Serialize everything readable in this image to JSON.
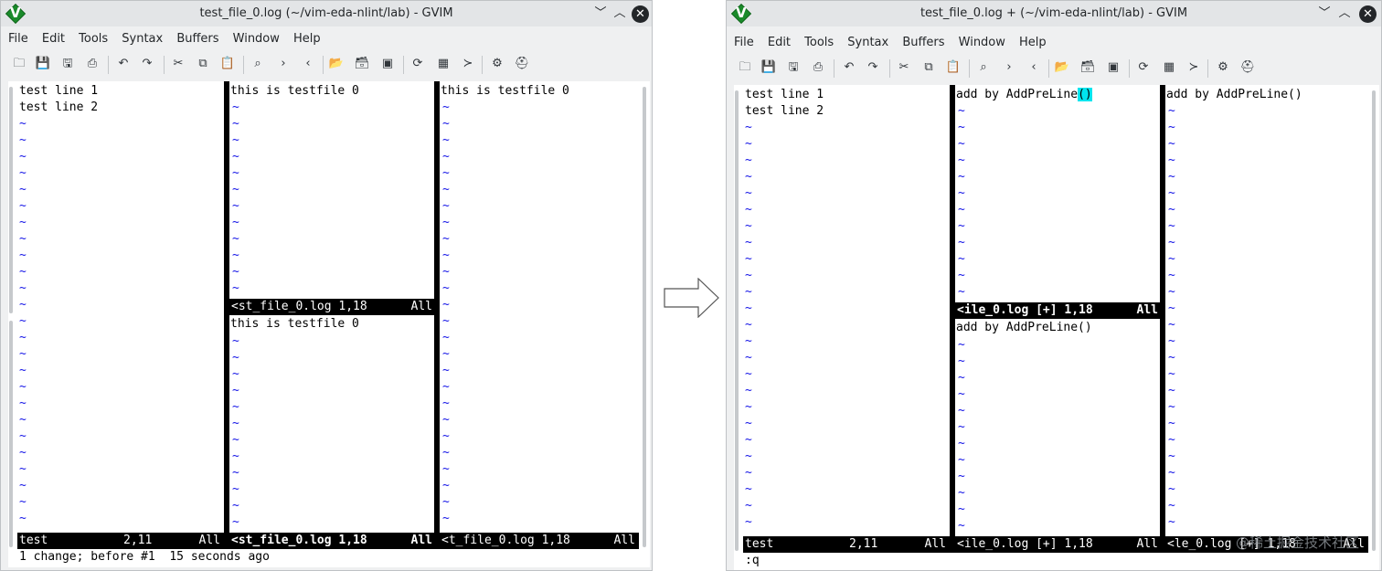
{
  "left_window": {
    "title": "test_file_0.log (~/vim-eda-nlint/lab) - GVIM",
    "menu": [
      "File",
      "Edit",
      "Tools",
      "Syntax",
      "Buffers",
      "Window",
      "Help"
    ],
    "pane1_lines": [
      "test line 1",
      "test line 2"
    ],
    "pane2_top_lines": [
      "this is testfile 0"
    ],
    "pane2_top_status": {
      "left": "<st_file_0.log 1,18",
      "right": "All"
    },
    "pane2_bottom_lines": [
      "this is testfile 0"
    ],
    "pane3_lines": [
      "this is testfile 0"
    ],
    "status": {
      "pane1": {
        "left": "test",
        "mid": "2,11",
        "right": "All"
      },
      "pane2": {
        "left": "<st_file_0.log 1,18",
        "right": "All"
      },
      "pane3": {
        "left": "<t_file_0.log 1,18",
        "right": "All"
      }
    },
    "cmdline": "1 change; before #1  15 seconds ago"
  },
  "right_window": {
    "title": "test_file_0.log + (~/vim-eda-nlint/lab) - GVIM",
    "menu": [
      "File",
      "Edit",
      "Tools",
      "Syntax",
      "Buffers",
      "Window",
      "Help"
    ],
    "pane1_lines": [
      "test line 1",
      "test line 2"
    ],
    "pane2_top_line_prefix": "add by AddPreLine",
    "pane2_top_line_match": "()",
    "pane2_top_status": {
      "left": "<ile_0.log [+] 1,18",
      "right": "All"
    },
    "pane2_bottom_lines": [
      "add by AddPreLine()"
    ],
    "pane3_lines": [
      "add by AddPreLine()"
    ],
    "status": {
      "pane1": {
        "left": "test",
        "mid": "2,11",
        "right": "All"
      },
      "pane2": {
        "left": "<ile_0.log [+] 1,18",
        "right": "All"
      },
      "pane3": {
        "left": "<le_0.log [+] 1,18",
        "right": "All"
      }
    },
    "cmdline": ":q"
  },
  "window_controls": {
    "minimize": "﹀",
    "maximize": "︿",
    "close": "✕"
  },
  "tilde": "~",
  "toolbar_icons": [
    "open-icon",
    "save-icon",
    "save-all-icon",
    "print-icon",
    "undo-icon",
    "redo-icon",
    "cut-icon",
    "copy-icon",
    "paste-icon",
    "find-replace-icon",
    "find-next-icon",
    "find-prev-icon",
    "load-session-icon",
    "save-session-icon",
    "run-script-icon",
    "make-icon",
    "shell-icon",
    "ctags-icon",
    "tag-jump-icon",
    "help-icon",
    "find-help-icon"
  ],
  "toolbar_glyphs": [
    "🗀",
    "💾",
    "🖫",
    "⎙",
    "↶",
    "↷",
    "✂",
    "⧉",
    "📋",
    "⌕",
    "›",
    "‹",
    "📂",
    "🗃",
    "▣",
    "⟳",
    "▦",
    "≻",
    "⚙",
    "⛑"
  ],
  "watermark": "@稀土掘金技术社区",
  "colors": {
    "tilde": "#1414e6",
    "match_highlight": "#00e5ee",
    "status_bg": "#000000"
  }
}
